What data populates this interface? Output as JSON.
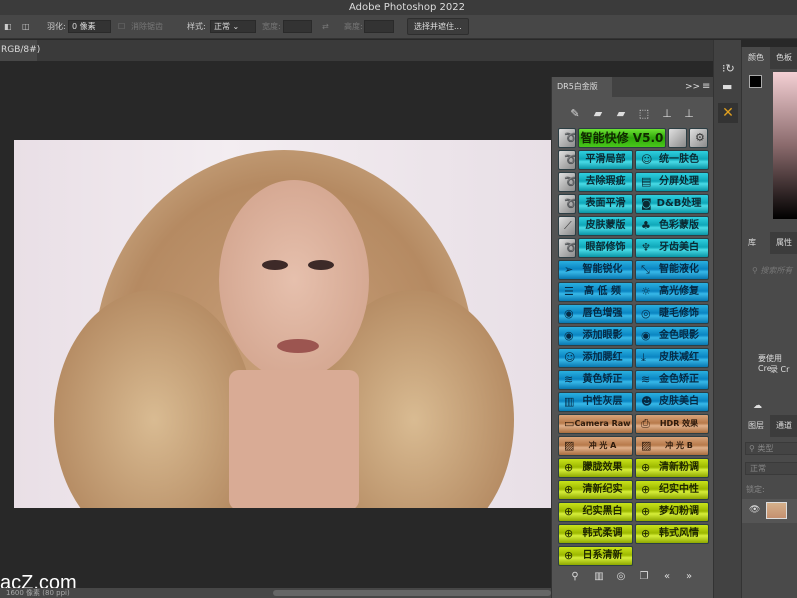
{
  "title": "Adobe Photoshop 2022",
  "options": {
    "feather_label": "羽化:",
    "feather_value": "0 像素",
    "antialias_label": "消除锯齿",
    "style_label": "样式:",
    "style_value": "正常",
    "width_label": "宽度:",
    "height_label": "高度:",
    "select_mask_button": "选择并遮住..."
  },
  "document_tab": "RGB/8#)",
  "status": "1600 像素 (80 ppi)",
  "watermark": "acZ.com",
  "dr5": {
    "tab": "DR5白金版",
    "expand": ">>",
    "menu": "≡",
    "title_button": "智能快修 V5.0",
    "small_rows": [
      {
        "left": "平滑局部",
        "right": "统一肤色",
        "ric": "☺"
      },
      {
        "left": "去除瑕疵",
        "right": "分屏处理",
        "ric": "▤"
      },
      {
        "left": "表面平滑",
        "right": "D&B处理",
        "ric": "◙"
      },
      {
        "left": "皮肤蒙版",
        "right": "色彩蒙版",
        "ric": "♣"
      },
      {
        "left": "眼部修饰",
        "right": "牙齿美白",
        "ric": "♆"
      }
    ],
    "blue_rows": [
      {
        "left": "智能锐化",
        "lic": "➢",
        "right": "智能液化",
        "ric": "⤡"
      },
      {
        "left": "高 低 频",
        "lic": "☰",
        "right": "高光修复",
        "ric": "☼"
      },
      {
        "left": "唇色增强",
        "lic": "◉",
        "right": "睫毛修饰",
        "ric": "◎"
      },
      {
        "left": "添加眼影",
        "lic": "◉",
        "right": "金色眼影",
        "ric": "◉"
      },
      {
        "left": "添加腮红",
        "lic": "☺",
        "right": "皮肤减红",
        "ric": "⤓"
      },
      {
        "left": "黄色矫正",
        "lic": "≋",
        "right": "金色矫正",
        "ric": "≋"
      },
      {
        "left": "中性灰层",
        "lic": "▥",
        "right": "皮肤美白",
        "ric": "☻"
      }
    ],
    "bronze_rows": [
      {
        "left": "Camera Raw",
        "lic": "▭",
        "right": "HDR 效果",
        "ric": "⎙"
      },
      {
        "left": "冲 光 A",
        "lic": "▨",
        "right": "冲 光 B",
        "ric": "▨"
      }
    ],
    "lime_rows": [
      {
        "left": "朦胧效果",
        "right": "清新粉调"
      },
      {
        "left": "清新纪实",
        "right": "纪实中性"
      },
      {
        "left": "纪实黑白",
        "right": "梦幻粉调"
      },
      {
        "left": "韩式柔调",
        "right": "韩式风情"
      },
      {
        "left": "日系清新"
      }
    ]
  },
  "right_panels": {
    "color_tab": "颜色",
    "swatches_tab": "色板",
    "library_tab": "库",
    "properties_tab": "属性",
    "library_search": "搜索所有",
    "library_msg1": "要使用 Cre",
    "library_msg2": "录 Cr",
    "layers_tab": "图层",
    "channels_tab": "通道",
    "kind_filter": "类型",
    "blend_mode": "正常",
    "lock_label": "锁定:"
  }
}
